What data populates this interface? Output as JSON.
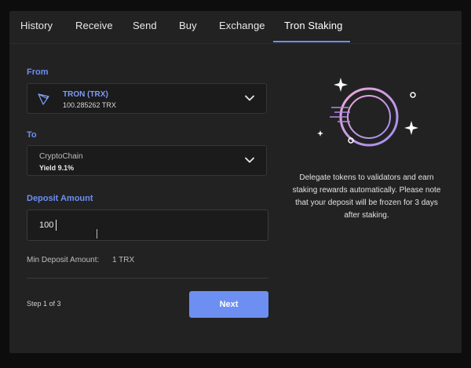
{
  "tabs": [
    {
      "label": "History"
    },
    {
      "label": "Receive"
    },
    {
      "label": "Send"
    },
    {
      "label": "Buy"
    },
    {
      "label": "Exchange"
    },
    {
      "label": "Tron Staking"
    }
  ],
  "active_tab": "Tron Staking",
  "from": {
    "label": "From",
    "token_name": "TRON (TRX)",
    "token_balance": "100.285262 TRX",
    "icon": "tron-logo-icon"
  },
  "to": {
    "label": "To",
    "validator_name": "CryptoChain",
    "yield_text": "Yield 9.1%"
  },
  "deposit": {
    "label": "Deposit Amount",
    "value": "100"
  },
  "min_deposit": {
    "label": "Min Deposit Amount:",
    "value": "1 TRX"
  },
  "step_text": "Step 1 of 3",
  "next_label": "Next",
  "description": "Delegate tokens to validators and earn staking rewards automatically. Please note that your deposit will be frozen for 3 days after staking.",
  "colors": {
    "accent": "#6d8ff2",
    "panel": "#222222",
    "field": "#1b1b1b"
  }
}
